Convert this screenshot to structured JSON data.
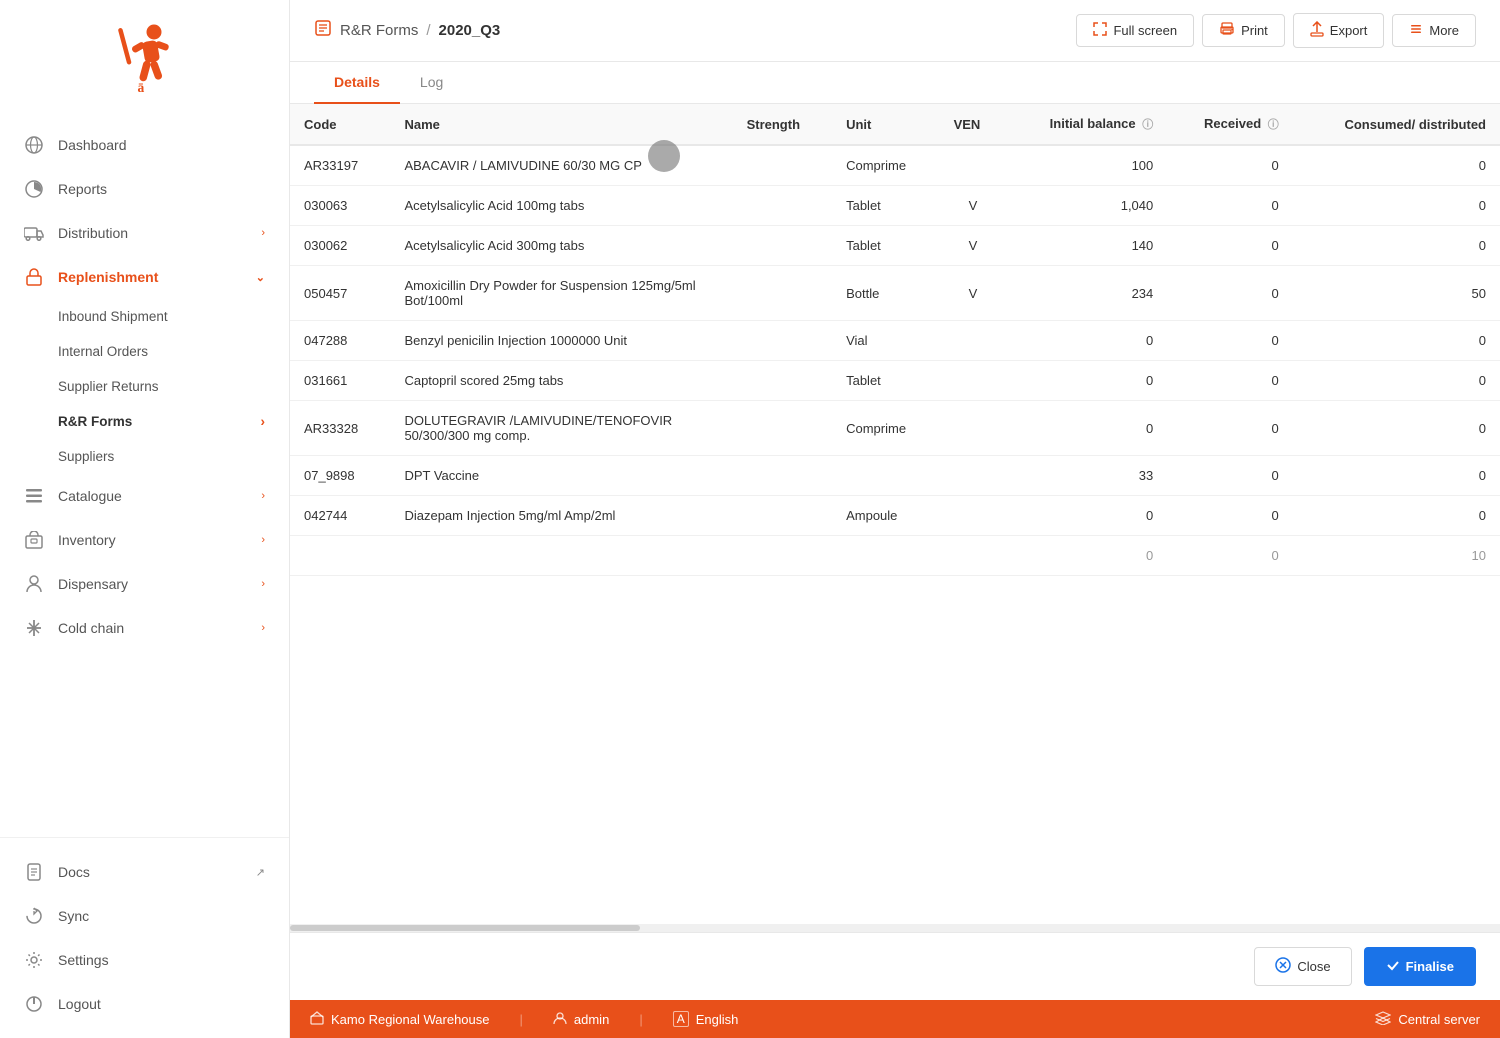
{
  "app": {
    "logo_alt": "mSupply logo"
  },
  "sidebar": {
    "items": [
      {
        "id": "dashboard",
        "label": "Dashboard",
        "icon": "globe-icon",
        "active": false,
        "expandable": false
      },
      {
        "id": "reports",
        "label": "Reports",
        "icon": "chart-icon",
        "active": false,
        "expandable": false
      },
      {
        "id": "distribution",
        "label": "Distribution",
        "icon": "truck-icon",
        "active": false,
        "expandable": true
      },
      {
        "id": "replenishment",
        "label": "Replenishment",
        "icon": "replenish-icon",
        "active": true,
        "expandable": true,
        "expanded": true
      }
    ],
    "replenishment_sub": [
      {
        "id": "inbound-shipment",
        "label": "Inbound Shipment",
        "active": false
      },
      {
        "id": "internal-orders",
        "label": "Internal Orders",
        "active": false
      },
      {
        "id": "supplier-returns",
        "label": "Supplier Returns",
        "active": false
      },
      {
        "id": "rr-forms",
        "label": "R&R Forms",
        "active": true,
        "has_chevron": true
      },
      {
        "id": "suppliers",
        "label": "Suppliers",
        "active": false
      }
    ],
    "bottom_items": [
      {
        "id": "catalogue",
        "label": "Catalogue",
        "icon": "list-icon",
        "expandable": true
      },
      {
        "id": "inventory",
        "label": "Inventory",
        "icon": "inventory-icon",
        "expandable": true
      },
      {
        "id": "dispensary",
        "label": "Dispensary",
        "icon": "person-icon",
        "expandable": true
      },
      {
        "id": "cold-chain",
        "label": "Cold chain",
        "icon": "cold-icon",
        "expandable": true
      },
      {
        "id": "docs",
        "label": "Docs",
        "icon": "docs-icon",
        "expandable": false,
        "external": true
      },
      {
        "id": "sync",
        "label": "Sync",
        "icon": "sync-icon",
        "expandable": false
      },
      {
        "id": "settings",
        "label": "Settings",
        "icon": "settings-icon",
        "expandable": false
      },
      {
        "id": "logout",
        "label": "Logout",
        "icon": "logout-icon",
        "expandable": false
      }
    ]
  },
  "header": {
    "breadcrumb_icon": "📋",
    "breadcrumb_root": "R&R Forms",
    "breadcrumb_sep": "/",
    "breadcrumb_current": "2020_Q3",
    "actions": [
      {
        "id": "fullscreen",
        "label": "Full screen",
        "icon": "fullscreen-icon"
      },
      {
        "id": "print",
        "label": "Print",
        "icon": "print-icon"
      },
      {
        "id": "export",
        "label": "Export",
        "icon": "export-icon"
      },
      {
        "id": "more",
        "label": "More",
        "icon": "more-icon"
      }
    ]
  },
  "tabs": [
    {
      "id": "details",
      "label": "Details",
      "active": true
    },
    {
      "id": "log",
      "label": "Log",
      "active": false
    }
  ],
  "table": {
    "columns": [
      {
        "id": "code",
        "label": "Code"
      },
      {
        "id": "name",
        "label": "Name"
      },
      {
        "id": "strength",
        "label": "Strength"
      },
      {
        "id": "unit",
        "label": "Unit"
      },
      {
        "id": "ven",
        "label": "VEN"
      },
      {
        "id": "initial_balance",
        "label": "Initial balance",
        "has_info": true
      },
      {
        "id": "received",
        "label": "Received",
        "has_info": true
      },
      {
        "id": "consumed",
        "label": "Consumed/ distributed"
      }
    ],
    "rows": [
      {
        "code": "AR33197",
        "name": "ABACAVIR / LAMIVUDINE 60/30 MG CP",
        "strength": "",
        "unit": "Comprime",
        "ven": "",
        "initial_balance": "100",
        "received": "0",
        "consumed": "0"
      },
      {
        "code": "030063",
        "name": "Acetylsalicylic Acid 100mg tabs",
        "strength": "",
        "unit": "Tablet",
        "ven": "V",
        "initial_balance": "1,040",
        "received": "0",
        "consumed": "0"
      },
      {
        "code": "030062",
        "name": "Acetylsalicylic Acid 300mg tabs",
        "strength": "",
        "unit": "Tablet",
        "ven": "V",
        "initial_balance": "140",
        "received": "0",
        "consumed": "0"
      },
      {
        "code": "050457",
        "name": "Amoxicillin Dry Powder for Suspension 125mg/5ml Bot/100ml",
        "strength": "",
        "unit": "Bottle",
        "ven": "V",
        "initial_balance": "234",
        "received": "0",
        "consumed": "50"
      },
      {
        "code": "047288",
        "name": "Benzyl penicilin Injection 1000000 Unit",
        "strength": "",
        "unit": "Vial",
        "ven": "",
        "initial_balance": "0",
        "received": "0",
        "consumed": "0"
      },
      {
        "code": "031661",
        "name": "Captopril scored 25mg tabs",
        "strength": "",
        "unit": "Tablet",
        "ven": "",
        "initial_balance": "0",
        "received": "0",
        "consumed": "0"
      },
      {
        "code": "AR33328",
        "name": "DOLUTEGRAVIR /LAMIVUDINE/TENOFOVIR 50/300/300 mg comp.",
        "strength": "",
        "unit": "Comprime",
        "ven": "",
        "initial_balance": "0",
        "received": "0",
        "consumed": "0"
      },
      {
        "code": "07_9898",
        "name": "DPT Vaccine",
        "strength": "",
        "unit": "",
        "ven": "",
        "initial_balance": "33",
        "received": "0",
        "consumed": "0"
      },
      {
        "code": "042744",
        "name": "Diazepam Injection 5mg/ml Amp/2ml",
        "strength": "",
        "unit": "Ampoule",
        "ven": "",
        "initial_balance": "0",
        "received": "0",
        "consumed": "0"
      },
      {
        "code": "...",
        "name": "...",
        "strength": "",
        "unit": "",
        "ven": "",
        "initial_balance": "0",
        "received": "0",
        "consumed": "10"
      }
    ]
  },
  "bottom_bar": {
    "close_label": "Close",
    "finalise_label": "Finalise"
  },
  "status_bar": {
    "warehouse": "Kamo Regional Warehouse",
    "user": "admin",
    "language": "English",
    "server": "Central server"
  }
}
